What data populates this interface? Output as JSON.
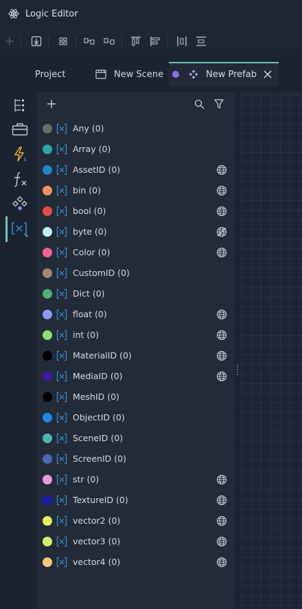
{
  "window": {
    "title": "Logic Editor",
    "icon": "atom-icon"
  },
  "toolbar": {
    "buttons": [
      {
        "name": "add",
        "icon": "plus-icon"
      },
      {
        "name": "import",
        "icon": "download-box-icon"
      },
      {
        "name": "grid",
        "icon": "grid-icon"
      },
      {
        "name": "node-a",
        "icon": "node-connect-icon"
      },
      {
        "name": "node-b",
        "icon": "node-disconnect-icon"
      },
      {
        "name": "align-top",
        "icon": "align-top-icon"
      },
      {
        "name": "align-left",
        "icon": "align-left-icon"
      },
      {
        "name": "distribute-h",
        "icon": "distribute-horizontal-icon"
      },
      {
        "name": "distribute-v",
        "icon": "distribute-vertical-icon"
      }
    ]
  },
  "tabs": [
    {
      "label": "Project",
      "icon": "",
      "active": false
    },
    {
      "label": "New Scene",
      "icon": "clapperboard-icon",
      "active": false
    },
    {
      "label": "New Prefab",
      "icon": "prefab-icon",
      "active": true,
      "dot_color": "#8b6df2",
      "close": "close-icon"
    }
  ],
  "sidebar": {
    "items": [
      {
        "name": "hierarchy",
        "icon": "hierarchy-icon",
        "color": "#c8ced8"
      },
      {
        "name": "toolbox",
        "icon": "toolbox-icon",
        "color": "#c8ced8"
      },
      {
        "name": "events",
        "icon": "lightning-icon",
        "color": "#f0b429"
      },
      {
        "name": "functions",
        "icon": "function-icon",
        "color": "#c8ced8"
      },
      {
        "name": "prefabs",
        "icon": "diamonds-icon",
        "color": "#a77cf5"
      },
      {
        "name": "variables",
        "icon": "variable-icon",
        "color": "#3b8ed6",
        "active": true
      }
    ]
  },
  "panel": {
    "add_icon": "plus-icon",
    "search_icon": "search-icon",
    "filter_icon": "filter-icon",
    "rows": [
      {
        "label": "Any (0)",
        "color": "#6b6b6b",
        "globe": ""
      },
      {
        "label": "Array (0)",
        "color": "#2aa6a6",
        "globe": ""
      },
      {
        "label": "AssetID (0)",
        "color": "#1e88c7",
        "globe": "globe"
      },
      {
        "label": "bin (0)",
        "color": "#f0955a",
        "globe": "globe"
      },
      {
        "label": "bool (0)",
        "color": "#e64b4b",
        "globe": "globe"
      },
      {
        "label": "byte (0)",
        "color": "#b9f2ef",
        "globe": "globe-off"
      },
      {
        "label": "Color (0)",
        "color": "#f06292",
        "globe": "globe"
      },
      {
        "label": "CustomID (0)",
        "color": "#a08a74",
        "globe": ""
      },
      {
        "label": "Dict (0)",
        "color": "#4fb07a",
        "globe": ""
      },
      {
        "label": "float (0)",
        "color": "#8c9aef",
        "globe": "globe"
      },
      {
        "label": "int (0)",
        "color": "#8ee06b",
        "globe": "globe"
      },
      {
        "label": "MaterialID (0)",
        "color": "#000000",
        "globe": "globe"
      },
      {
        "label": "MediaID (0)",
        "color": "#3e1aa3",
        "globe": "globe"
      },
      {
        "label": "MeshID (0)",
        "color": "#000000",
        "globe": ""
      },
      {
        "label": "ObjectID (0)",
        "color": "#1e88e5",
        "globe": ""
      },
      {
        "label": "SceneID (0)",
        "color": "#4fb3b0",
        "globe": ""
      },
      {
        "label": "ScreenID (0)",
        "color": "#4b68b5",
        "globe": ""
      },
      {
        "label": "str (0)",
        "color": "#e89ad8",
        "globe": "globe"
      },
      {
        "label": "TextureID (0)",
        "color": "#1a1aa8",
        "globe": "globe"
      },
      {
        "label": "vector2 (0)",
        "color": "#e3f05a",
        "globe": "globe"
      },
      {
        "label": "vector3 (0)",
        "color": "#d2f06b",
        "globe": "globe"
      },
      {
        "label": "vector4 (0)",
        "color": "#f5c77a",
        "globe": "globe"
      }
    ]
  }
}
